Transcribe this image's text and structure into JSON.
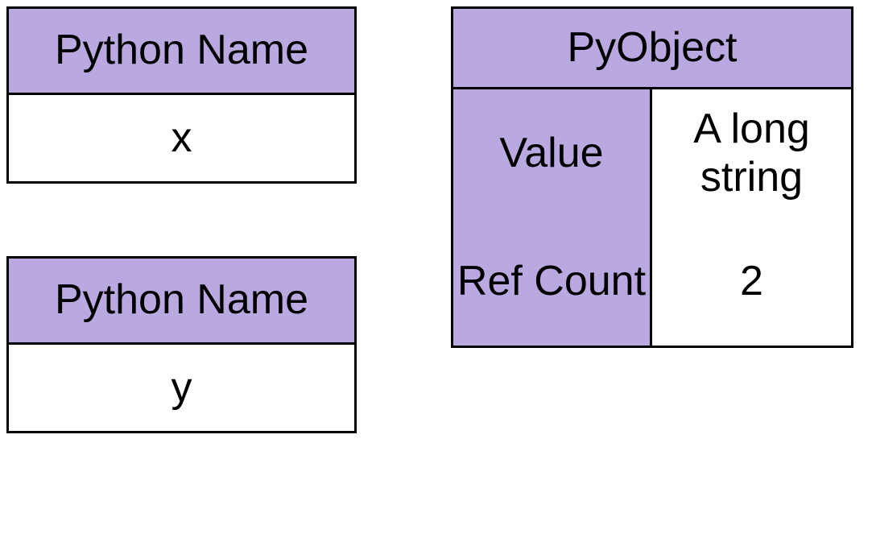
{
  "nameX": {
    "header": "Python Name",
    "value": "x"
  },
  "nameY": {
    "header": "Python Name",
    "value": "y"
  },
  "pyObject": {
    "header": "PyObject",
    "valueLabel": "Value",
    "valueContent": "A long string",
    "refCountLabel": "Ref Count",
    "refCountValue": "2"
  }
}
